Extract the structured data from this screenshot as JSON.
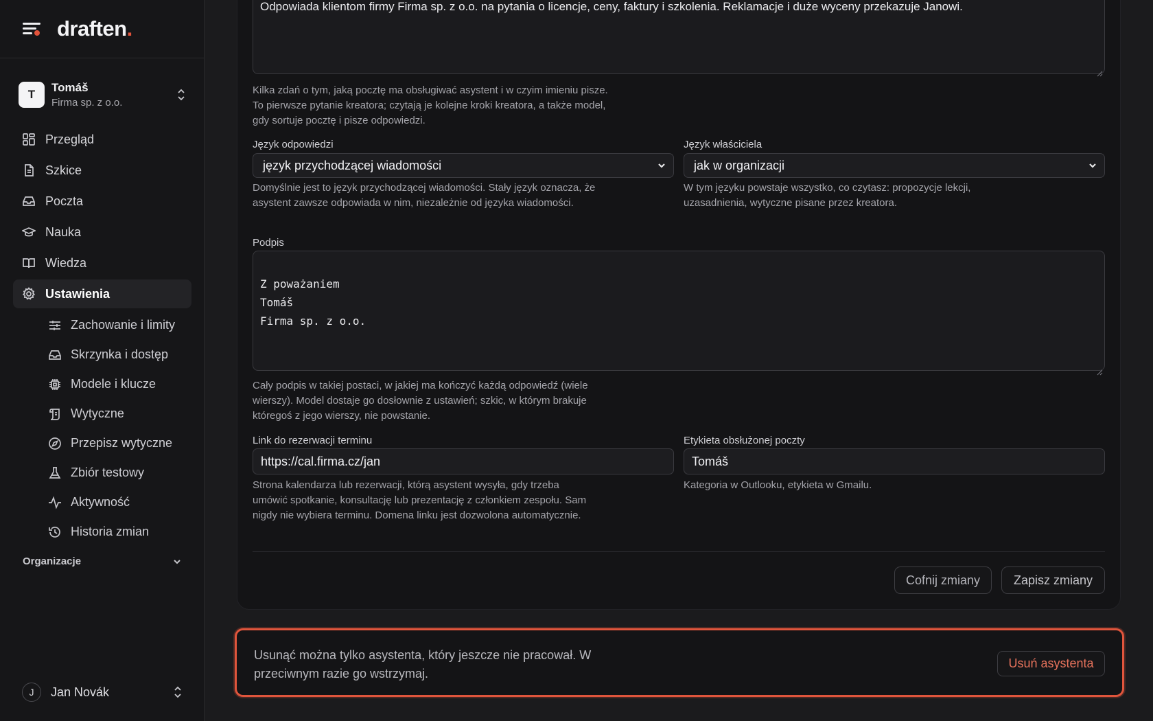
{
  "brand": {
    "name": "draften",
    "dot": "."
  },
  "account": {
    "initial": "T",
    "name": "Tomáš",
    "org": "Firma sp. z o.o."
  },
  "nav": [
    {
      "label": "Przegląd",
      "icon": "dashboard-icon"
    },
    {
      "label": "Szkice",
      "icon": "document-icon"
    },
    {
      "label": "Poczta",
      "icon": "inbox-icon"
    },
    {
      "label": "Nauka",
      "icon": "graduation-cap-icon"
    },
    {
      "label": "Wiedza",
      "icon": "book-icon"
    },
    {
      "label": "Ustawienia",
      "icon": "gear-icon",
      "active": true
    }
  ],
  "subnav": [
    {
      "label": "Zachowanie i limity",
      "icon": "sliders-icon"
    },
    {
      "label": "Skrzynka i dostęp",
      "icon": "inbox-icon"
    },
    {
      "label": "Modele i klucze",
      "icon": "chip-icon"
    },
    {
      "label": "Wytyczne",
      "icon": "scroll-icon"
    },
    {
      "label": "Przepisz wytyczne",
      "icon": "compass-icon"
    },
    {
      "label": "Zbiór testowy",
      "icon": "flask-icon"
    },
    {
      "label": "Aktywność",
      "icon": "activity-icon"
    },
    {
      "label": "Historia zmian",
      "icon": "history-icon"
    }
  ],
  "org_section": {
    "label": "Organizacje"
  },
  "user": {
    "initial": "J",
    "name": "Jan Novák"
  },
  "form": {
    "description_value": "Odpowiada klientom firmy Firma sp. z o.o. na pytania o licencje, ceny, faktury i szkolenia. Reklamacje i duże wyceny przekazuje Janowi.",
    "description_help": "Kilka zdań o tym, jaką pocztę ma obsługiwać asystent i w czyim imieniu pisze. To pierwsze pytanie kreatora; czytają je kolejne kroki kreatora, a także model, gdy sortuje pocztę i pisze odpowiedzi.",
    "reply_language": {
      "label": "Język odpowiedzi",
      "value": "język przychodzącej wiadomości",
      "help": "Domyślnie jest to język przychodzącej wiadomości. Stały język oznacza, że asystent zawsze odpowiada w nim, niezależnie od języka wiadomości."
    },
    "owner_language": {
      "label": "Język właściciela",
      "value": "jak w organizacji",
      "help": "W tym języku powstaje wszystko, co czytasz: propozycje lekcji, uzasadnienia, wytyczne pisane przez kreatora."
    },
    "signature": {
      "label": "Podpis",
      "value": "Z poważaniem\nTomáš\nFirma sp. z o.o.",
      "help": "Cały podpis w takiej postaci, w jakiej ma kończyć każdą odpowiedź (wiele wierszy). Model dostaje go dosłownie z ustawień; szkic, w którym brakuje któregoś z jego wierszy, nie powstanie."
    },
    "booking_link": {
      "label": "Link do rezerwacji terminu",
      "value": "https://cal.firma.cz/jan",
      "help": "Strona kalendarza lub rezerwacji, którą asystent wysyła, gdy trzeba umówić spotkanie, konsultację lub prezentację z członkiem zespołu. Sam nigdy nie wybiera terminu. Domena linku jest dozwolona automatycznie."
    },
    "handled_label": {
      "label": "Etykieta obsłużonej poczty",
      "value": "Tomáš",
      "help": "Kategoria w Outlooku, etykieta w Gmailu."
    },
    "revert_label": "Cofnij zmiany",
    "save_label": "Zapisz zmiany"
  },
  "danger": {
    "text": "Usunąć można tylko asystenta, który jeszcze nie pracował. W przeciwnym razie go wstrzymaj.",
    "button": "Usuń asystenta"
  },
  "colors": {
    "accent": "#e2533b",
    "background": "#1b1b1d",
    "sidebar": "#161618"
  }
}
